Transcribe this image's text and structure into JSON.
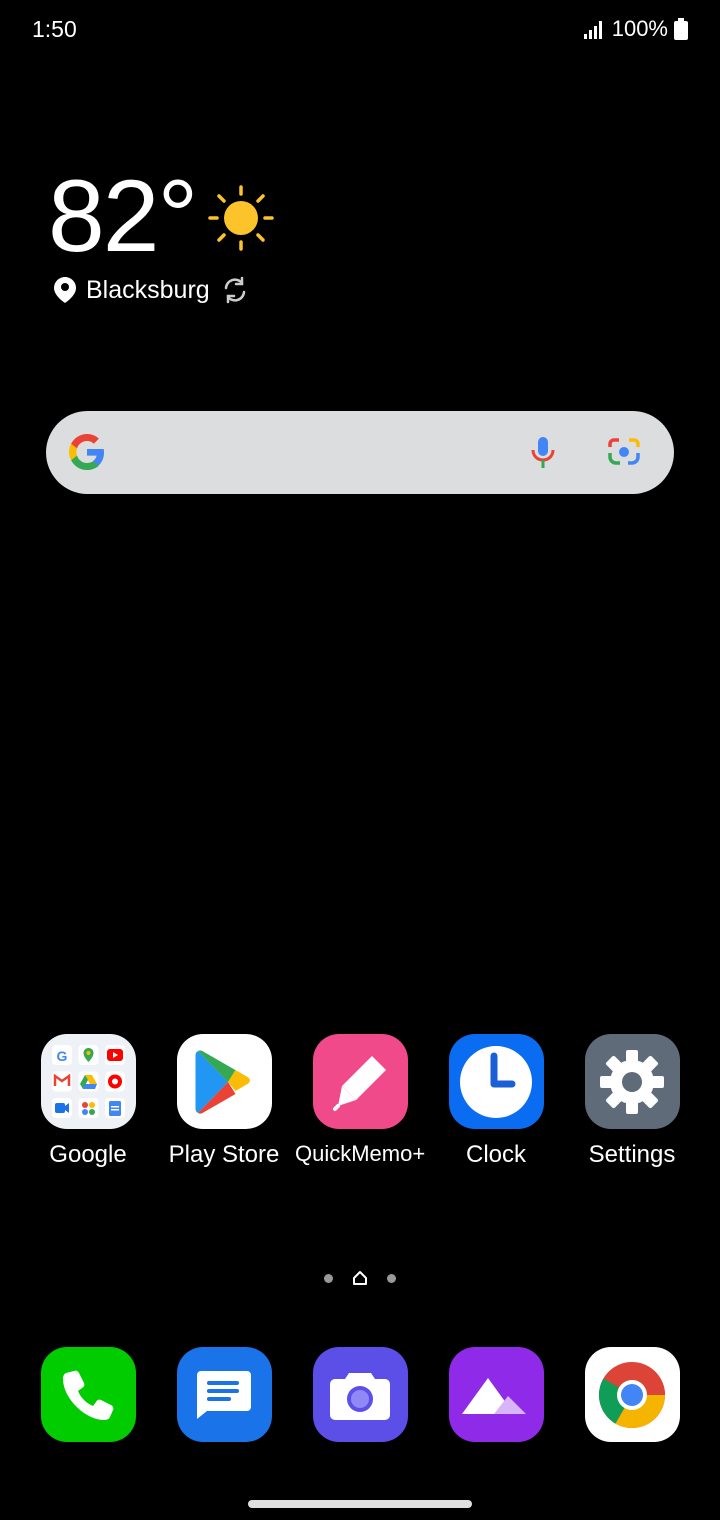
{
  "status": {
    "time": "1:50",
    "battery": "100%"
  },
  "weather": {
    "temperature": "82°",
    "location": "Blacksburg",
    "condition_icon": "sun-icon"
  },
  "search": {
    "icons": [
      "google-g-icon",
      "microphone-icon",
      "google-lens-icon"
    ]
  },
  "apps": [
    {
      "name": "google-folder",
      "label": "Google"
    },
    {
      "name": "play-store",
      "label": "Play Store"
    },
    {
      "name": "quickmemo",
      "label": "QuickMemo+"
    },
    {
      "name": "clock",
      "label": "Clock"
    },
    {
      "name": "settings",
      "label": "Settings"
    }
  ],
  "dock": [
    "phone",
    "messages",
    "camera",
    "gallery",
    "chrome"
  ],
  "colors": {
    "background": "#000000",
    "search_bar": "#dcdddf",
    "phone": "#00cc00",
    "messages": "#1a73e8",
    "camera": "#5b4fe8",
    "gallery": "#8f2be8",
    "quickmemo": "#f04a8a",
    "clock": "#0a6cf0",
    "settings": "#5f6b78"
  }
}
